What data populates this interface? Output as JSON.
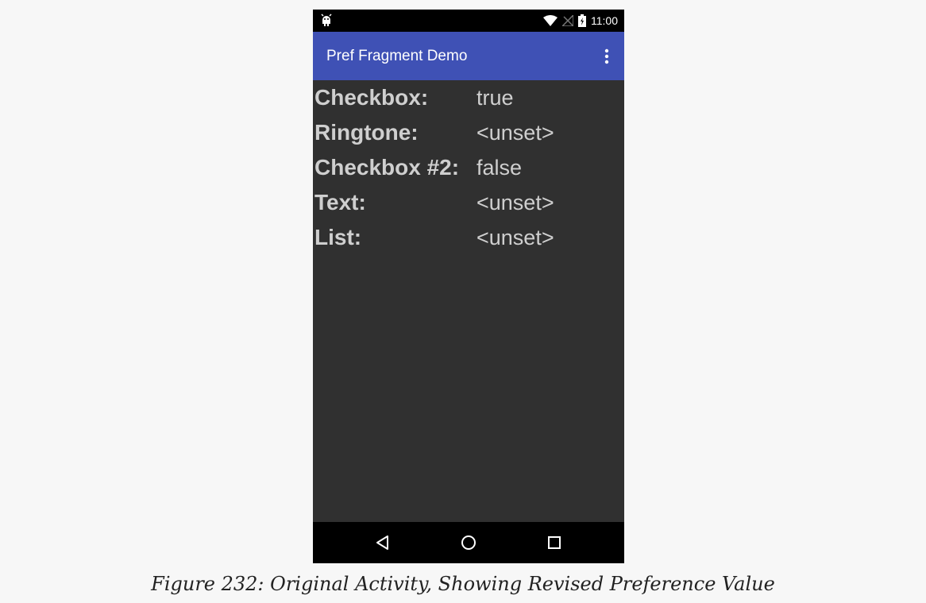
{
  "status_bar": {
    "time": "11:00",
    "icons": [
      "android-debug-icon",
      "wifi-icon",
      "no-signal-icon",
      "battery-charging-icon"
    ]
  },
  "app_bar": {
    "title": "Pref Fragment Demo",
    "overflow_icon": "more-vert-icon"
  },
  "preferences": [
    {
      "label": "Checkbox:",
      "value": "true"
    },
    {
      "label": "Ringtone:",
      "value": "<unset>"
    },
    {
      "label": "Checkbox #2:",
      "value": "false"
    },
    {
      "label": "Text:",
      "value": "<unset>"
    },
    {
      "label": "List:",
      "value": "<unset>"
    }
  ],
  "nav_bar": {
    "buttons": [
      "back-icon",
      "home-icon",
      "recents-icon"
    ]
  },
  "caption": "Figure 232: Original Activity, Showing Revised Preference Value",
  "colors": {
    "app_bar": "#3f51b5",
    "background": "#303030",
    "text": "#cfcfcf",
    "page": "#f7f7f7"
  }
}
